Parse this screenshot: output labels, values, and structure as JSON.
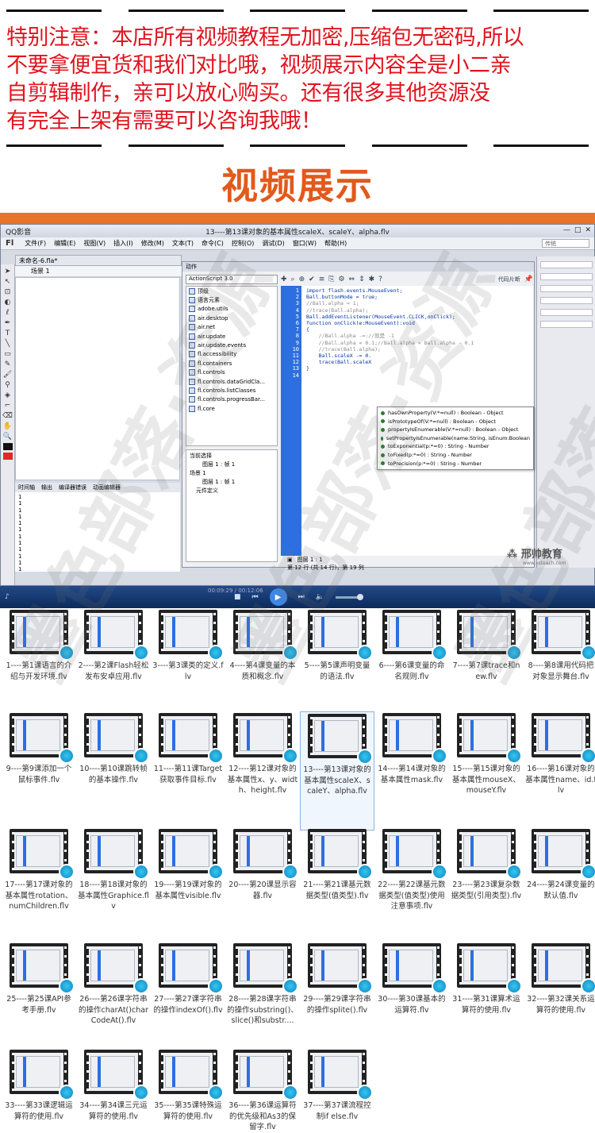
{
  "notice": {
    "lines": [
      "特别注意：本店所有视频教程无加密,压缩包无密码,所以",
      "不要拿便宜货和我们对比哦，视频展示内容全是小二亲",
      "自剪辑制作，亲可以放心购买。还有很多其他资源没",
      "有完全上架有需要可以咨询我哦！"
    ]
  },
  "showcase_title": "视频展示",
  "app": {
    "window_title": "13----第13课对象的基本属性scaleX、scaleY、alpha.flv",
    "player_name": "QQ影音",
    "menu": [
      "文件(F)",
      "编辑(E)",
      "视图(V)",
      "插入(I)",
      "修改(M)",
      "文本(T)",
      "命令(C)",
      "控制(O)",
      "调试(D)",
      "窗口(W)",
      "帮助(H)"
    ],
    "logo": "Fl",
    "search_placeholder": "传统",
    "doc_tab": "未命名-6.fla*",
    "scene": "场景 1",
    "actions_header": "动作",
    "as_version": "ActionScript 3.0",
    "as_items": [
      "顶级",
      "语言元素",
      "adobe.utils",
      "air.desktop",
      "air.net",
      "air.update",
      "air.update.events",
      "fl.accessibility",
      "fl.containers",
      "fl.controls",
      "fl.controls.dataGridCla...",
      "fl.controls.listClasses",
      "fl.controls.progressBar...",
      "fl.core"
    ],
    "tree": [
      "当前选择",
      "图层 1 : 帧 1",
      "场景 1",
      "图层 1 : 帧 1",
      "元件定义"
    ],
    "code_helper": "代码片断",
    "code_lines": [
      "import flash.events.MouseEvent;",
      "",
      "Ball.buttonMode = true;",
      "//Ball.alpha = 1;",
      "//trace(Ball.alpha);",
      "Ball.addEventListener(MouseEvent.CLICK,onClick);",
      "function onClick(e:MouseEvent):void",
      "{",
      "    //Ball.alpha -=://就是 -1",
      "    //Ball.alpha = 0.1;//Ball.alpha = Ball.alpha - 0.1",
      "    //trace(Ball.alpha);",
      "    Ball.scaleX -= 0.",
      "    trace(Ball.scaleX",
      "}"
    ],
    "autocomplete": [
      "hasOwnProperty(V:*=null) : Boolean - Object",
      "isPrototypeOf(V:*=null) : Boolean - Object",
      "propertyIsEnumerable(V:*=null) : Boolean - Object",
      "setPropertyIsEnumerable(name:String, isEnum:Boolean",
      "toExponential(p:*=0) : String - Number",
      "toFixed(p:*=0) : String - Number",
      "toPrecision(p:*=0) : String - Number"
    ],
    "layer_label": "图层 1 : 1",
    "status": "第 12 行 (共 14 行)，第 19 列",
    "output_tabs": [
      "时间轴",
      "输出",
      "编译器错误",
      "动画编辑器"
    ],
    "output_lines": [
      "1",
      "1",
      "1",
      "1",
      "1",
      "1",
      "1",
      "1",
      "1",
      "1",
      "1",
      "1"
    ],
    "brand": "邢帅教育",
    "brand_url": "www.xsteach.com",
    "time": "00:09:29 / 00:12:06"
  },
  "files": [
    "1----第1课语言的介绍与开发环境.flv",
    "2----第2课Flash轻松发布安卓应用.flv",
    "3----第3课类的定义.flv",
    "4----第4课变量的本质和概念.flv",
    "5----第5课声明变量的语法.flv",
    "6----第6课变量的命名规则.flv",
    "7----第7课trace和new.flv",
    "8----第8课用代码把对象显示舞台.flv",
    "9----第9课添加一个鼠标事件.flv",
    "10----第10课跳转帧的基本操作.flv",
    "11----第11课Target获取事件目标.flv",
    "12----第12课对象的基本属性x、y、width、height.flv",
    "13----第13课对象的基本属性scaleX、scaleY、alpha.flv",
    "14----第14课对象的基本属性mask.flv",
    "15----第15课对象的基本属性mouseX、mouseY.flv",
    "16----第16课对象的基本属性name、id.flv",
    "17----第17课对象的基本属性rotation、numChildren.flv",
    "18----第18课对象的基本属性Graphice.flv",
    "19----第19课对象的基本属性visible.flv",
    "20----第20课显示容器.flv",
    "21----第21课基元数据类型(值类型).flv",
    "22----第22课基元数据类型(值类型)使用注意事项.flv",
    "23----第23课复杂数据类型(引用类型).flv",
    "24----第24课变量的默认值.flv",
    "25----第25课API参考手册.flv",
    "26----第26课字符串的操作charAt()charCodeAt().flv",
    "27----第27课字符串的操作indexOf().flv",
    "28----第28课字符串的操作substring()、slice()和substr....",
    "29----第29课字符串的操作splite().flv",
    "30----第30课基本的运算符.flv",
    "31----第31课算术运算符的使用.flv",
    "32----第32课关系运算符的使用.flv",
    "33----第33课逻辑运算符的使用.flv",
    "34----第34课三元运算符的使用.flv",
    "35----第35课特殊运算符的使用.flv",
    "36----第36课运算符的优先级和As3的保留字.flv",
    "37----第37课流程控制if else.flv"
  ],
  "selected_index": 12,
  "watermark": "墨色部落·资源"
}
